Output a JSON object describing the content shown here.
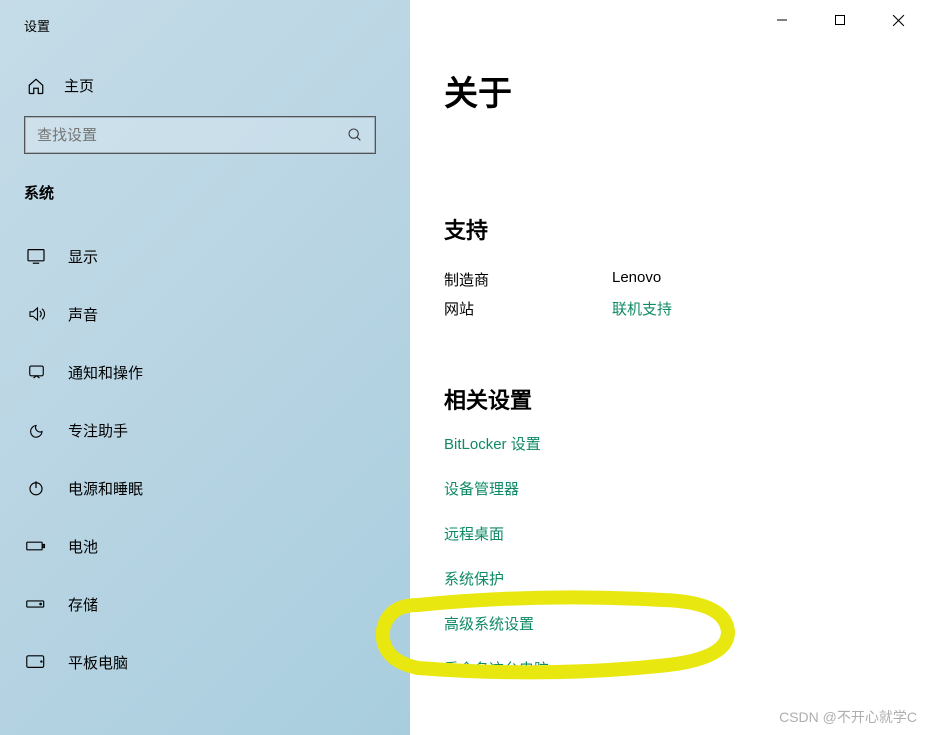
{
  "window": {
    "title": "设置"
  },
  "sidebar": {
    "home_label": "主页",
    "search_placeholder": "查找设置",
    "section_label": "系统",
    "items": [
      {
        "label": "显示",
        "icon": "display"
      },
      {
        "label": "声音",
        "icon": "sound"
      },
      {
        "label": "通知和操作",
        "icon": "notifications"
      },
      {
        "label": "专注助手",
        "icon": "focus"
      },
      {
        "label": "电源和睡眠",
        "icon": "power"
      },
      {
        "label": "电池",
        "icon": "battery"
      },
      {
        "label": "存储",
        "icon": "storage"
      },
      {
        "label": "平板电脑",
        "icon": "tablet"
      }
    ]
  },
  "main": {
    "title": "关于",
    "support": {
      "heading": "支持",
      "manufacturer_label": "制造商",
      "manufacturer_value": "Lenovo",
      "website_label": "网站",
      "website_value": "联机支持"
    },
    "related": {
      "heading": "相关设置",
      "links": [
        "BitLocker 设置",
        "设备管理器",
        "远程桌面",
        "系统保护",
        "高级系统设置",
        "重命名这台电脑"
      ]
    }
  },
  "watermark": "CSDN @不开心就学C"
}
